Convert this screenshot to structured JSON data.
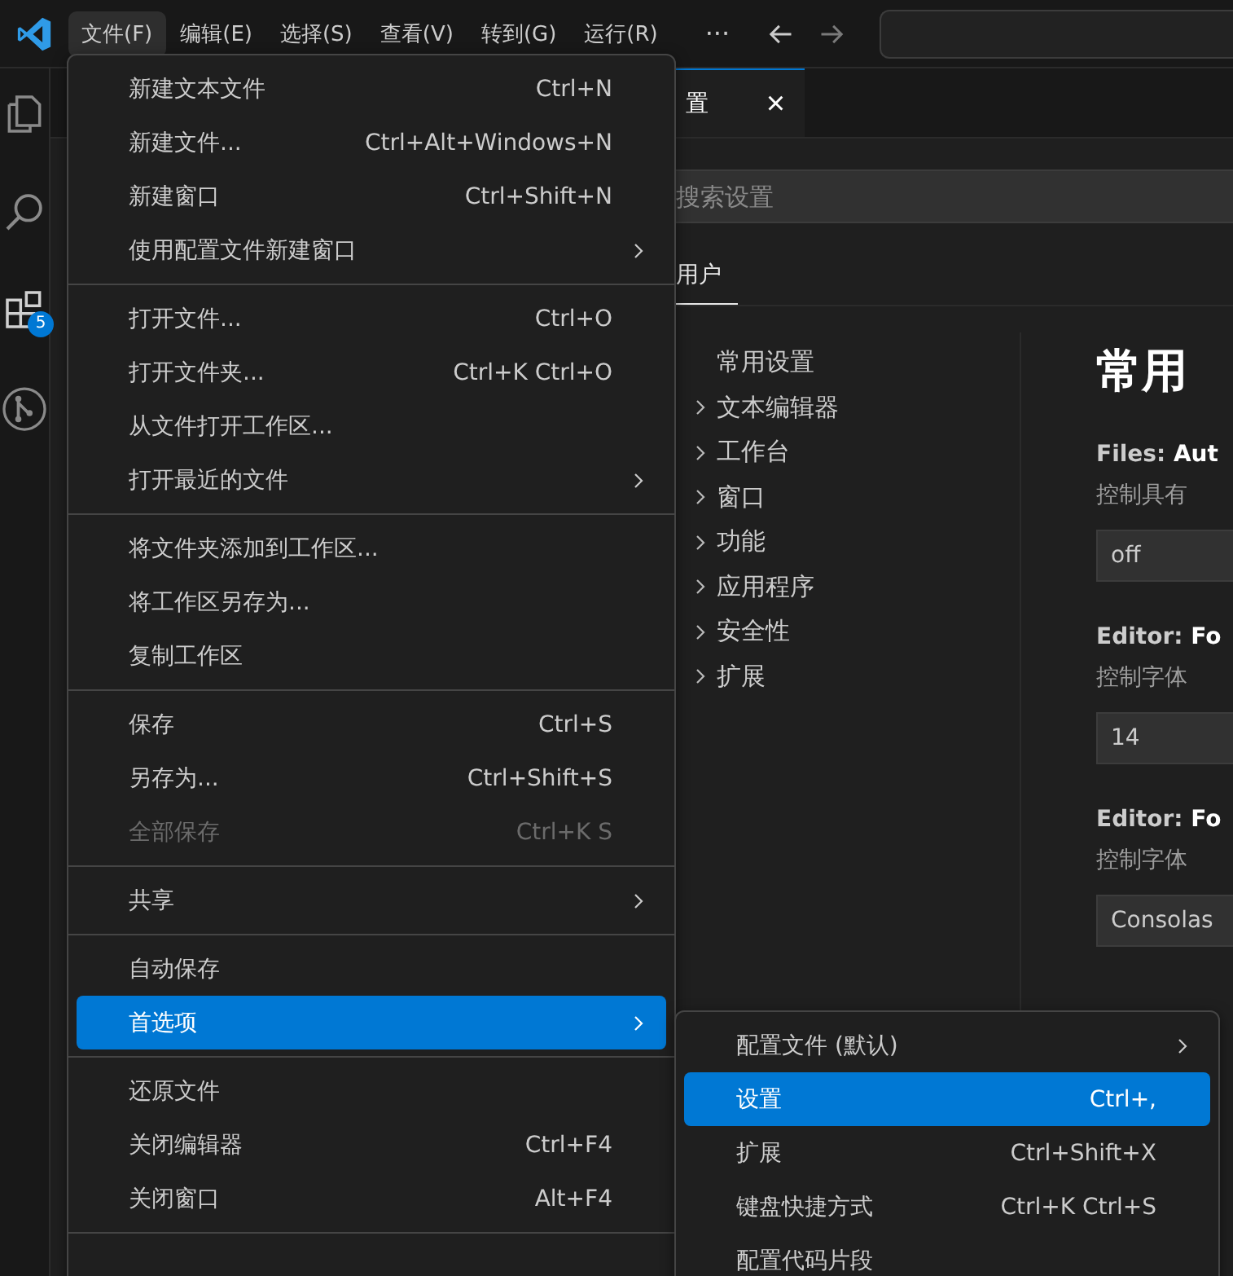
{
  "menubar": {
    "items": [
      {
        "label": "文件(F)",
        "selected": true
      },
      {
        "label": "编辑(E)",
        "selected": false
      },
      {
        "label": "选择(S)",
        "selected": false
      },
      {
        "label": "查看(V)",
        "selected": false
      },
      {
        "label": "转到(G)",
        "selected": false
      },
      {
        "label": "运行(R)",
        "selected": false
      }
    ],
    "more": "···"
  },
  "activity_bar": {
    "extensions_badge": "5"
  },
  "tab": {
    "label": "置",
    "close": "×"
  },
  "search": {
    "placeholder": "搜索设置"
  },
  "scope_tabs": [
    {
      "label": "用户",
      "selected": true
    }
  ],
  "toc": [
    {
      "label": "常用设置",
      "expandable": false
    },
    {
      "label": "文本编辑器",
      "expandable": true
    },
    {
      "label": "工作台",
      "expandable": true
    },
    {
      "label": "窗口",
      "expandable": true
    },
    {
      "label": "功能",
      "expandable": true
    },
    {
      "label": "应用程序",
      "expandable": true
    },
    {
      "label": "安全性",
      "expandable": true
    },
    {
      "label": "扩展",
      "expandable": true
    }
  ],
  "settings": {
    "heading": "常用",
    "items": [
      {
        "title": "Files: **Aut**",
        "description": "控制具有",
        "value": "off"
      },
      {
        "title": "Editor: **Fo**",
        "description": "控制字体",
        "value": "14"
      },
      {
        "title": "Editor: **Fo**",
        "description": "控制字体",
        "value": "Consolas"
      }
    ]
  },
  "file_menu": {
    "groups": [
      [
        {
          "label": "新建文本文件",
          "shortcut": "Ctrl+N",
          "has_submenu": false,
          "disabled": false,
          "selected": false
        },
        {
          "label": "新建文件...",
          "shortcut": "Ctrl+Alt+Windows+N",
          "has_submenu": false,
          "disabled": false,
          "selected": false
        },
        {
          "label": "新建窗口",
          "shortcut": "Ctrl+Shift+N",
          "has_submenu": false,
          "disabled": false,
          "selected": false
        },
        {
          "label": "使用配置文件新建窗口",
          "has_submenu": true,
          "disabled": false,
          "selected": false
        }
      ],
      [
        {
          "label": "打开文件...",
          "shortcut": "Ctrl+O",
          "has_submenu": false,
          "disabled": false,
          "selected": false
        },
        {
          "label": "打开文件夹...",
          "shortcut": "Ctrl+K Ctrl+O",
          "has_submenu": false,
          "disabled": false,
          "selected": false
        },
        {
          "label": "从文件打开工作区...",
          "has_submenu": false,
          "disabled": false,
          "selected": false
        },
        {
          "label": "打开最近的文件",
          "has_submenu": true,
          "disabled": false,
          "selected": false
        }
      ],
      [
        {
          "label": "将文件夹添加到工作区...",
          "has_submenu": false,
          "disabled": false,
          "selected": false
        },
        {
          "label": "将工作区另存为...",
          "has_submenu": false,
          "disabled": false,
          "selected": false
        },
        {
          "label": "复制工作区",
          "has_submenu": false,
          "disabled": false,
          "selected": false
        }
      ],
      [
        {
          "label": "保存",
          "shortcut": "Ctrl+S",
          "has_submenu": false,
          "disabled": false,
          "selected": false
        },
        {
          "label": "另存为...",
          "shortcut": "Ctrl+Shift+S",
          "has_submenu": false,
          "disabled": false,
          "selected": false
        },
        {
          "label": "全部保存",
          "shortcut": "Ctrl+K S",
          "has_submenu": false,
          "disabled": true,
          "selected": false
        }
      ],
      [
        {
          "label": "共享",
          "has_submenu": true,
          "disabled": false,
          "selected": false
        }
      ],
      [
        {
          "label": "自动保存",
          "has_submenu": false,
          "disabled": false,
          "selected": false
        },
        {
          "label": "首选项",
          "has_submenu": true,
          "disabled": false,
          "selected": true
        }
      ],
      [
        {
          "label": "还原文件",
          "has_submenu": false,
          "disabled": false,
          "selected": false
        },
        {
          "label": "关闭编辑器",
          "shortcut": "Ctrl+F4",
          "has_submenu": false,
          "disabled": false,
          "selected": false
        },
        {
          "label": "关闭窗口",
          "shortcut": "Alt+F4",
          "has_submenu": false,
          "disabled": false,
          "selected": false
        }
      ]
    ]
  },
  "preferences_submenu": {
    "items": [
      {
        "label": "配置文件 (默认)",
        "has_submenu": true,
        "disabled": false,
        "selected": false
      },
      {
        "label": "设置",
        "shortcut": "Ctrl+,",
        "has_submenu": false,
        "disabled": false,
        "selected": true
      },
      {
        "label": "扩展",
        "shortcut": "Ctrl+Shift+X",
        "has_submenu": false,
        "disabled": false,
        "selected": false
      },
      {
        "label": "键盘快捷方式",
        "shortcut": "Ctrl+K Ctrl+S",
        "has_submenu": false,
        "disabled": false,
        "selected": false
      },
      {
        "label": "配置代码片段",
        "has_submenu": false,
        "disabled": false,
        "selected": false
      }
    ]
  }
}
